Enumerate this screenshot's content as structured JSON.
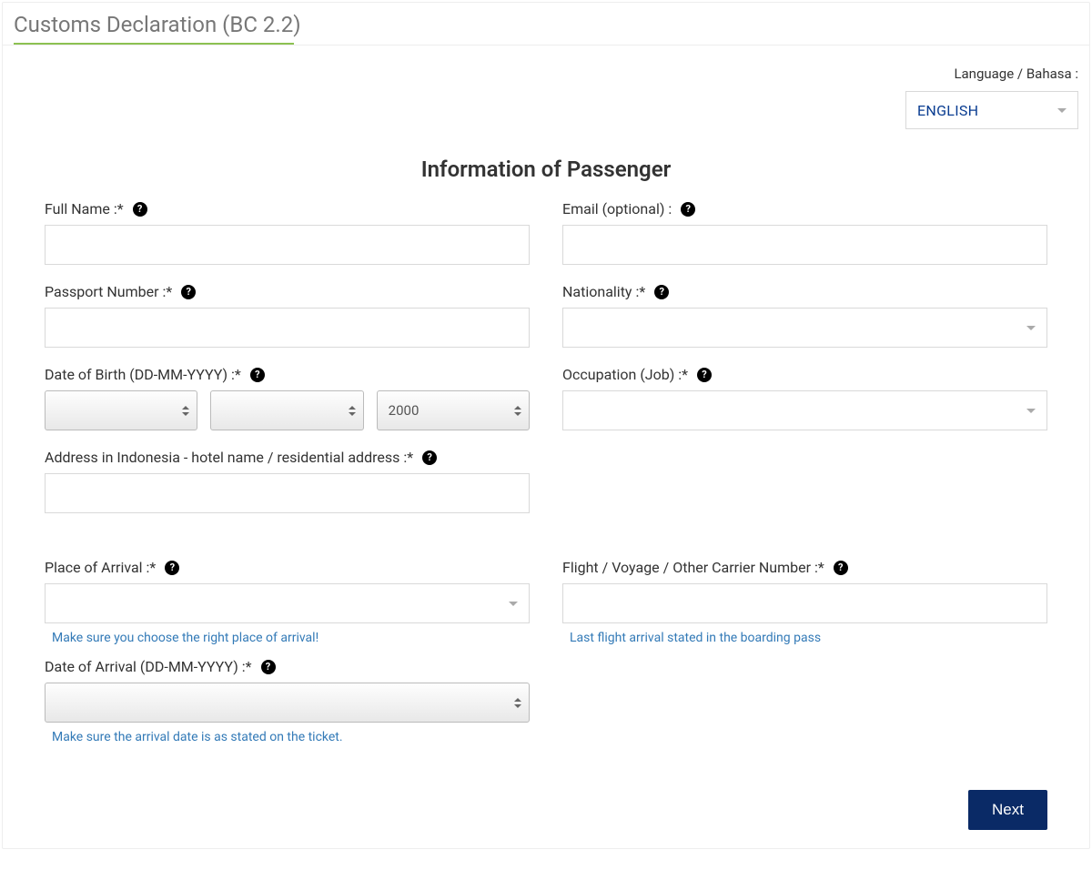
{
  "page": {
    "title": "Customs Declaration (BC 2.2)",
    "language_label": "Language / Bahasa :",
    "language_selected": "ENGLISH",
    "section_title": "Information of Passenger"
  },
  "fields": {
    "full_name": {
      "label": "Full Name :*",
      "value": ""
    },
    "email": {
      "label": "Email (optional) :",
      "value": ""
    },
    "passport": {
      "label": "Passport Number :*",
      "value": ""
    },
    "nationality": {
      "label": "Nationality :*",
      "value": ""
    },
    "dob": {
      "label": "Date of Birth (DD-MM-YYYY) :*",
      "day": "",
      "month": "",
      "year": "2000"
    },
    "occupation": {
      "label": "Occupation (Job) :*",
      "value": ""
    },
    "address": {
      "label": "Address in Indonesia - hotel name / residential address :*",
      "value": ""
    },
    "place_of_arrival": {
      "label": "Place of Arrival :*",
      "value": "",
      "hint": "Make sure you choose the right place of arrival!"
    },
    "carrier": {
      "label": "Flight / Voyage / Other Carrier Number :*",
      "value": "",
      "hint": "Last flight arrival stated in the boarding pass"
    },
    "date_of_arrival": {
      "label": "Date of Arrival (DD-MM-YYYY) :*",
      "value": "",
      "hint": "Make sure the arrival date is as stated on the ticket."
    }
  },
  "buttons": {
    "next": "Next"
  }
}
